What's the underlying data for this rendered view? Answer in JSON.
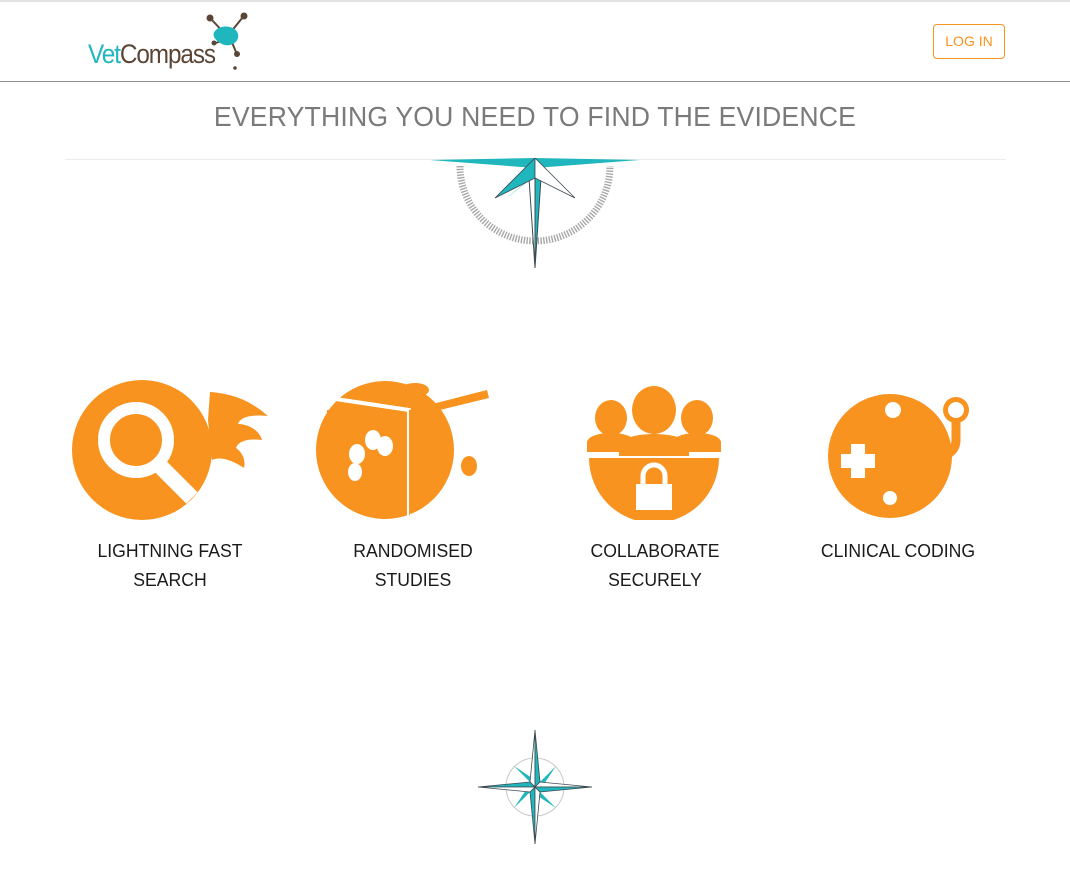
{
  "header": {
    "logo": {
      "part1": "Vet",
      "part2": "Compass"
    },
    "login_label": "LOG IN"
  },
  "hero": {
    "headline": "EVERYTHING YOU NEED TO FIND THE EVIDENCE"
  },
  "features": [
    {
      "label": "LIGHTNING FAST\nSEARCH",
      "icon": "search-icon"
    },
    {
      "label": "RANDOMISED\nSTUDIES",
      "icon": "dice-icon"
    },
    {
      "label": "COLLABORATE\nSECURELY",
      "icon": "secure-group-icon"
    },
    {
      "label": "CLINICAL CODING",
      "icon": "medical-code-icon"
    }
  ],
  "colors": {
    "brand_orange": "#f7931e",
    "brand_teal": "#1fb6be",
    "brand_brown": "#5a4636",
    "headline_gray": "#7a7a7a"
  }
}
